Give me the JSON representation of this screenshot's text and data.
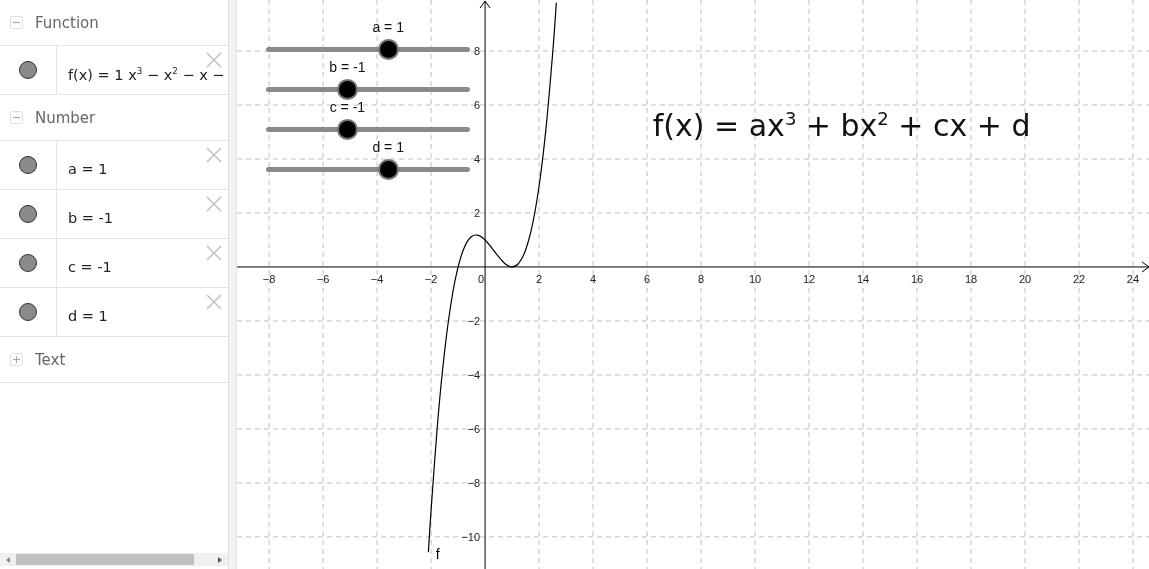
{
  "algebra": {
    "sections": [
      {
        "title": "Function",
        "expanded": true,
        "items": [
          {
            "text": "f(x) = 1 x$^{3}$ − x$^{2}$ − x −",
            "visible": true
          }
        ]
      },
      {
        "title": "Number",
        "expanded": true,
        "items": [
          {
            "text": "a = 1",
            "visible": true
          },
          {
            "text": "b = -1",
            "visible": true
          },
          {
            "text": "c = -1",
            "visible": true
          },
          {
            "text": "d = 1",
            "visible": true
          }
        ]
      },
      {
        "title": "Text",
        "expanded": false
      }
    ]
  },
  "graphics": {
    "sliders": [
      {
        "label": "a = 1",
        "level": 0.6
      },
      {
        "label": "b = -1",
        "level": 0.4
      },
      {
        "label": "c = -1",
        "level": 0.4
      },
      {
        "label": "d = 1",
        "level": 0.6
      }
    ],
    "formula": "f(x) = ax$^{3}$ + bx$^{2}$ + cx + d",
    "chart_data": {
      "type": "line",
      "grid": true,
      "xlim": [
        -9.19,
        24.63
      ],
      "ylim": [
        -11.19,
        9.89
      ],
      "xticks": [
        {
          "value": -8,
          "label": "−8"
        },
        {
          "value": -6,
          "label": "−6"
        },
        {
          "value": -4,
          "label": "−4"
        },
        {
          "value": -2,
          "label": "−2"
        },
        {
          "value": 0,
          "label": "0"
        },
        {
          "value": 2,
          "label": "2"
        },
        {
          "value": 4,
          "label": "4"
        },
        {
          "value": 6,
          "label": "6"
        },
        {
          "value": 8,
          "label": "8"
        },
        {
          "value": 10,
          "label": "10"
        },
        {
          "value": 12,
          "label": "12"
        },
        {
          "value": 14,
          "label": "14"
        },
        {
          "value": 16,
          "label": "16"
        },
        {
          "value": 18,
          "label": "18"
        },
        {
          "value": 20,
          "label": "20"
        },
        {
          "value": 22,
          "label": "22"
        },
        {
          "value": 24,
          "label": "24"
        }
      ],
      "yticks": [
        {
          "value": -10,
          "label": "−10"
        },
        {
          "value": -8,
          "label": "−8"
        },
        {
          "value": -6,
          "label": "−6"
        },
        {
          "value": -4,
          "label": "−4"
        },
        {
          "value": -2,
          "label": "−2"
        },
        {
          "value": 2,
          "label": "2"
        },
        {
          "value": 4,
          "label": "4"
        },
        {
          "value": 6,
          "label": "6"
        },
        {
          "value": 8,
          "label": "8"
        }
      ],
      "x": [
        -2.1,
        -2,
        -1.75,
        -1.5,
        -1.25,
        -1,
        -0.75,
        -0.5,
        -0.25,
        0,
        0.25,
        0.5,
        0.75,
        1,
        1.25,
        1.5,
        1.75,
        2,
        2.25,
        2.5,
        2.64
      ],
      "series": [
        {
          "name": "f",
          "color": "#000000",
          "values": [
            -10.57,
            -9,
            -5.67,
            -3.13,
            -1.27,
            0,
            0.77,
            1.13,
            1.17,
            1,
            0.7,
            0.38,
            0.11,
            0,
            0.14,
            0.63,
            1.55,
            3,
            5.08,
            7.88,
            9.79
          ]
        }
      ]
    }
  }
}
